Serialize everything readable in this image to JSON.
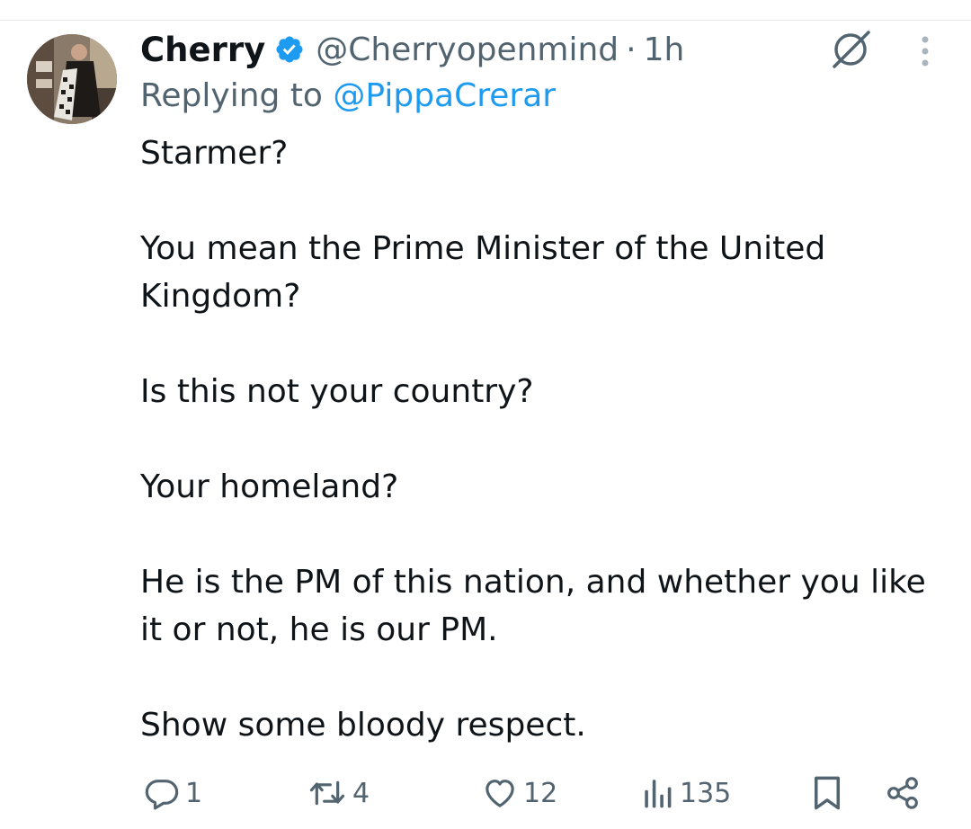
{
  "tweet": {
    "author": {
      "display_name": "Cherry",
      "handle": "@Cherryopenmind",
      "verified": true
    },
    "separator": "·",
    "time": "1h",
    "replying_prefix": "Replying to",
    "replying_to": "@PippaCrerar",
    "body": {
      "p1": "Starmer?",
      "p2": "You mean the Prime Minister of the United Kingdom?",
      "p3": "Is this not your country?",
      "p4": "Your homeland?",
      "p5": "He is the PM of this nation, and whether you like it or not, he is our PM.",
      "p6": "Show some bloody respect."
    }
  },
  "actions": {
    "replies": "1",
    "reposts": "4",
    "likes": "12",
    "views": "135"
  },
  "colors": {
    "text": "#0f1419",
    "secondary": "#536471",
    "accent": "#1d9bf0"
  },
  "icons": [
    "verified-badge-icon",
    "grok-icon",
    "more-vertical-icon",
    "reply-icon",
    "repost-icon",
    "like-icon",
    "views-icon",
    "bookmark-icon",
    "share-icon"
  ]
}
